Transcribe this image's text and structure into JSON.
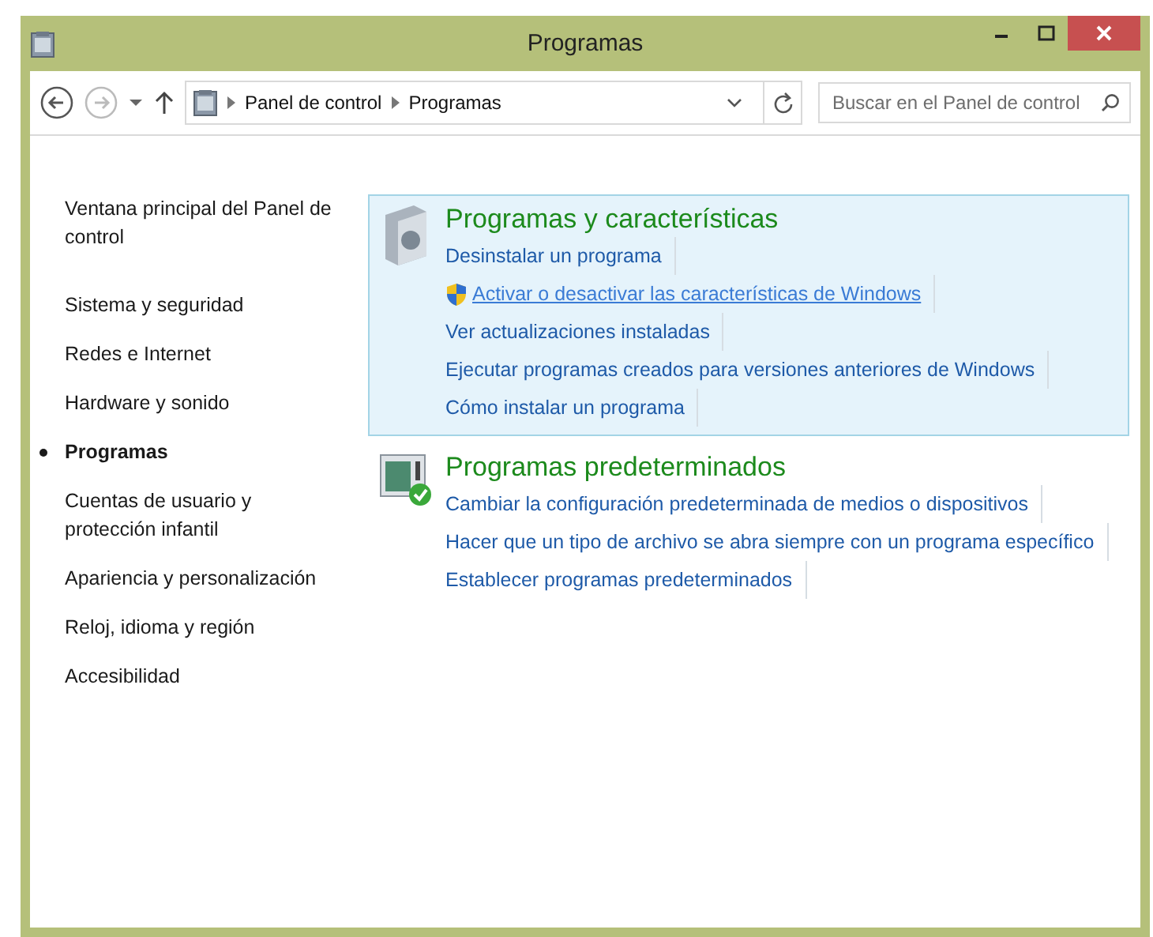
{
  "window": {
    "title": "Programas",
    "buttons": [
      {
        "kind": "minimize"
      },
      {
        "kind": "maximize"
      },
      {
        "kind": "close"
      }
    ]
  },
  "address_bar": {
    "breadcrumbs": [
      "Panel de control",
      "Programas"
    ]
  },
  "search": {
    "placeholder": "Buscar en el Panel de control"
  },
  "sidebar": {
    "items": [
      {
        "label": "Ventana principal del Panel de control",
        "selected": false
      },
      {
        "label": "Sistema y seguridad",
        "selected": false
      },
      {
        "label": "Redes e Internet",
        "selected": false
      },
      {
        "label": "Hardware y sonido",
        "selected": false
      },
      {
        "label": "Programas",
        "selected": true
      },
      {
        "label": "Cuentas de usuario y protección infantil",
        "selected": false
      },
      {
        "label": "Apariencia y personalización",
        "selected": false
      },
      {
        "label": "Reloj, idioma y región",
        "selected": false
      },
      {
        "label": "Accesibilidad",
        "selected": false
      }
    ]
  },
  "sections": [
    {
      "title": "Programas y características",
      "kind": "programs",
      "selected": true,
      "links": [
        {
          "label": "Desinstalar un programa",
          "shield": false,
          "hovered": false
        },
        {
          "label": "Activar o desactivar las características de Windows",
          "shield": true,
          "hovered": true
        },
        {
          "label": "Ver actualizaciones instaladas",
          "shield": false,
          "hovered": false
        },
        {
          "label": "Ejecutar programas creados para versiones anteriores de Windows",
          "shield": false,
          "hovered": false
        },
        {
          "label": "Cómo instalar un programa",
          "shield": false,
          "hovered": false
        }
      ]
    },
    {
      "title": "Programas predeterminados",
      "kind": "defaults",
      "selected": false,
      "links": [
        {
          "label": "Cambiar la configuración predeterminada de medios o dispositivos",
          "shield": false,
          "hovered": false
        },
        {
          "label": "Hacer que un tipo de archivo se abra siempre con un programa específico",
          "shield": false,
          "hovered": false
        },
        {
          "label": "Establecer programas predeterminados",
          "shield": false,
          "hovered": false
        }
      ]
    }
  ]
}
